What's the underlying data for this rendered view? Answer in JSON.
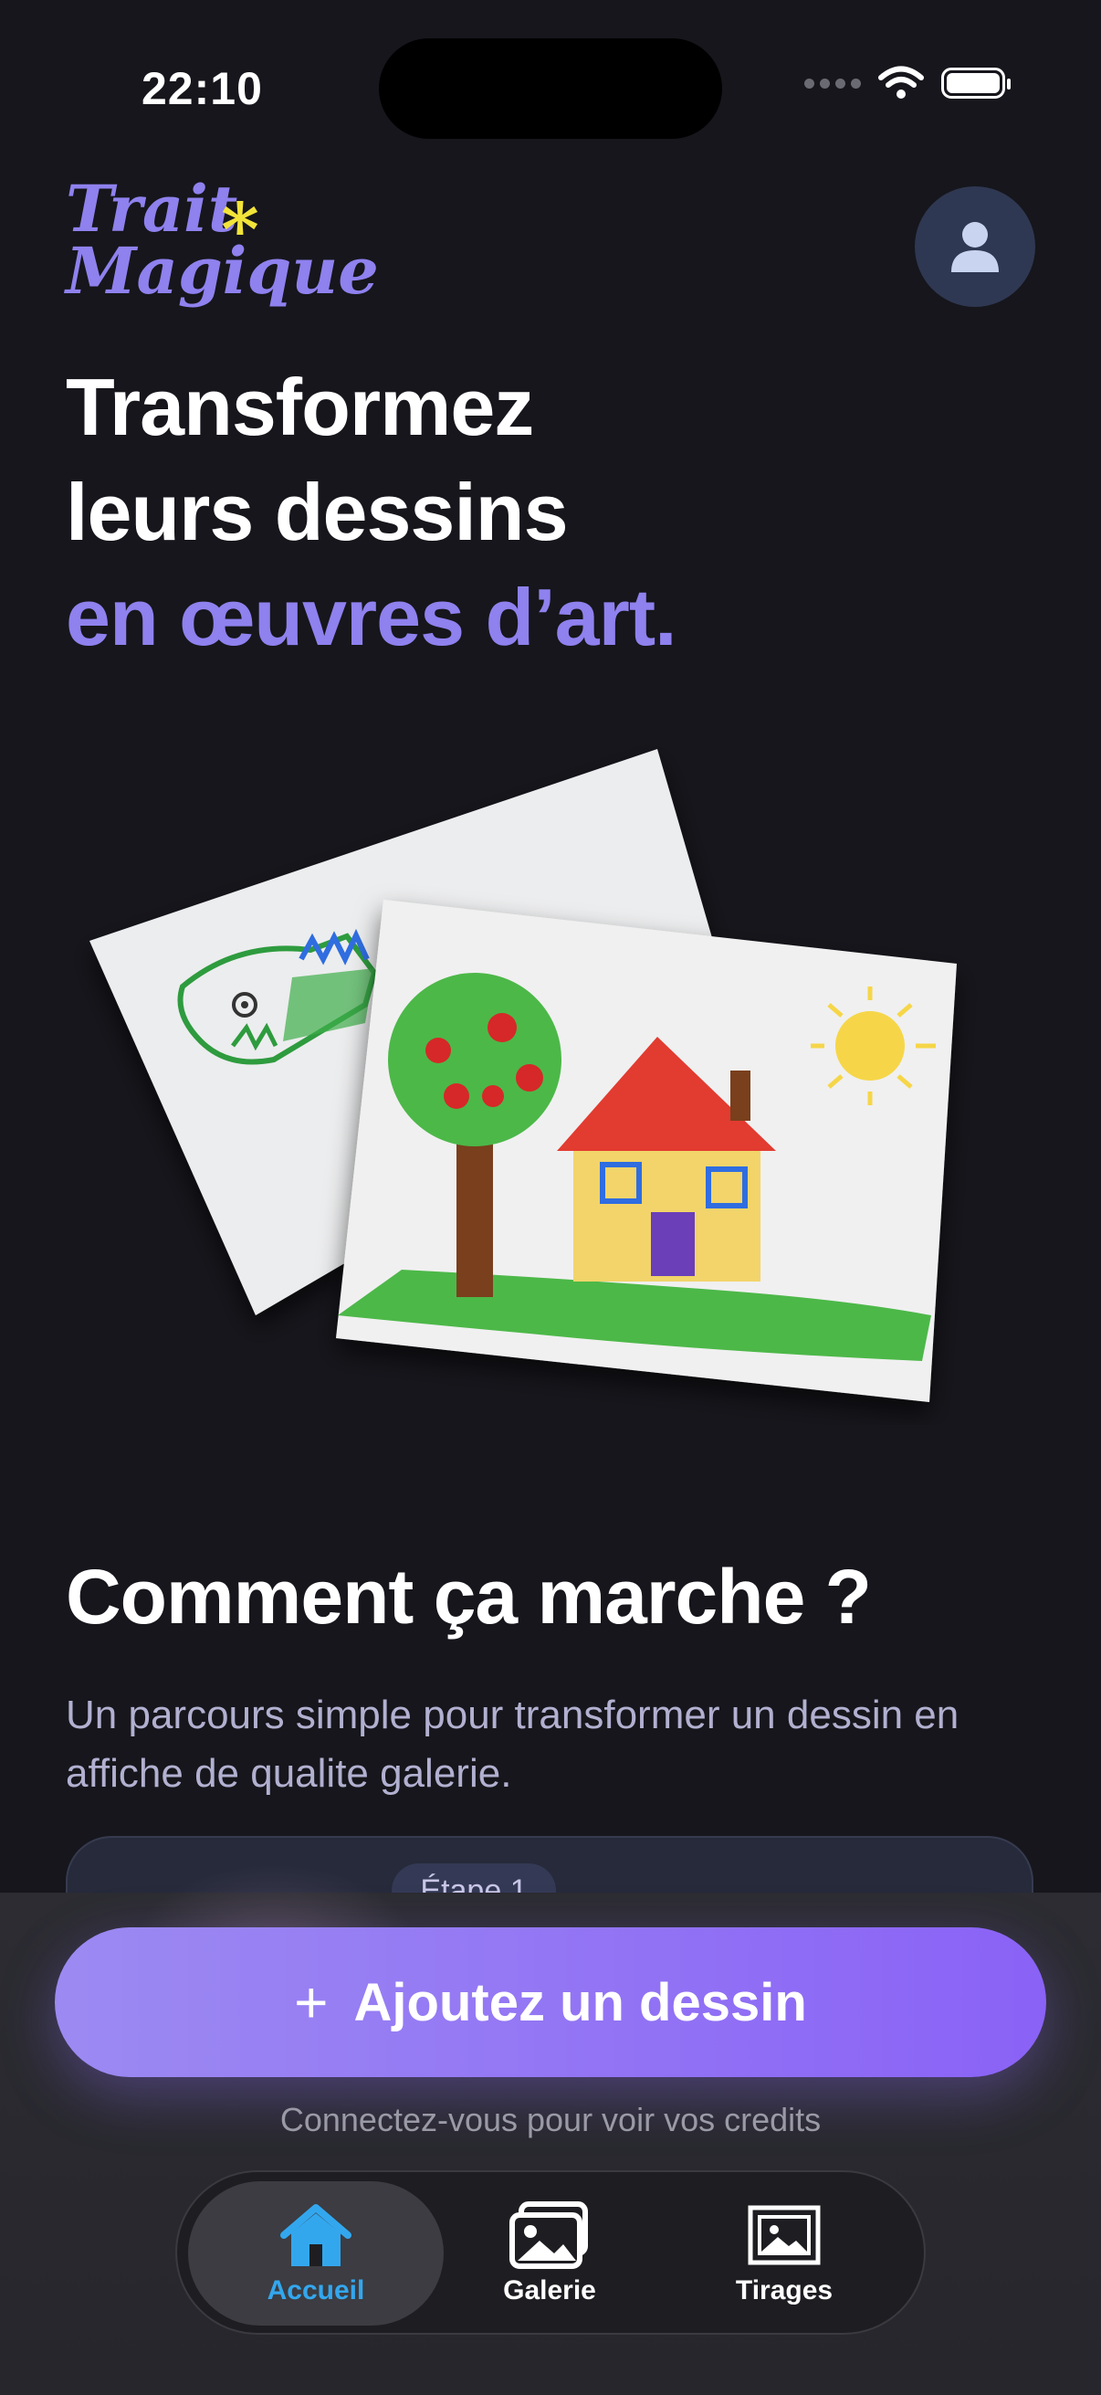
{
  "status_bar": {
    "time": "22:10"
  },
  "header": {
    "logo_line1": "Trait",
    "logo_line2": "Magique",
    "logo_star": "*"
  },
  "hero": {
    "line1": "Transformez",
    "line2": "leurs dessins",
    "line3": "en œuvres d’art."
  },
  "how_it_works": {
    "title": "Comment ça marche ?",
    "description": "Un parcours simple pour transformer un dessin en affiche de qualite galerie.",
    "step_label": "Étape 1"
  },
  "cta": {
    "icon": "+",
    "label": "Ajoutez un dessin"
  },
  "credits_text": "Connectez-vous pour voir vos credits",
  "tabs": [
    {
      "label": "Accueil",
      "icon": "home-icon",
      "active": true
    },
    {
      "label": "Galerie",
      "icon": "gallery-icon",
      "active": false
    },
    {
      "label": "Tirages",
      "icon": "prints-icon",
      "active": false
    }
  ],
  "colors": {
    "accent": "#8f81ee",
    "background": "#16161c",
    "active_tab": "#33a7ee",
    "star": "#f2e33a"
  }
}
